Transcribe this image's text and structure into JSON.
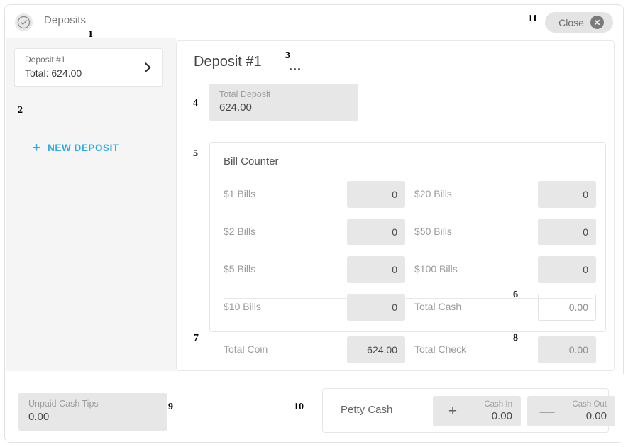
{
  "header": {
    "title": "Deposits",
    "status_icon": "check-circle-icon",
    "close_label": "Close",
    "close_icon": "close-x-icon"
  },
  "sidebar": {
    "deposit_item": {
      "name": "Deposit #1",
      "total": "Total: 624.00",
      "chevron_icon": "chevron-right-icon"
    },
    "new_deposit": {
      "plus": "+",
      "label": "NEW DEPOSIT",
      "color": "#2aabe2"
    }
  },
  "panel": {
    "title": "Deposit #1",
    "overflow_menu_icon": "ellipsis-horizontal-icon",
    "total_deposit": {
      "label": "Total Deposit",
      "value": "624.00"
    },
    "bill_counter": {
      "title": "Bill Counter",
      "rows": [
        {
          "left_label": "$1 Bills",
          "left_value": "0",
          "right_label": "$20 Bills",
          "right_value": "0"
        },
        {
          "left_label": "$2 Bills",
          "left_value": "0",
          "right_label": "$50 Bills",
          "right_value": "0"
        },
        {
          "left_label": "$5 Bills",
          "left_value": "0",
          "right_label": "$100 Bills",
          "right_value": "0"
        },
        {
          "left_label": "$10 Bills",
          "left_value": "0",
          "right_label": "Total Cash",
          "right_value": "0.00"
        }
      ],
      "totals_row": {
        "left_label": "Total Coin",
        "left_value": "624.00",
        "right_label": "Total Check",
        "right_value": "0.00"
      }
    }
  },
  "footer": {
    "unpaid_cash_tips": {
      "label": "Unpaid Cash Tips",
      "value": "0.00"
    },
    "petty_cash": {
      "label": "Petty Cash",
      "cash_in": {
        "sign": "+",
        "caption": "Cash In",
        "value": "0.00"
      },
      "cash_out": {
        "sign": "—",
        "caption": "Cash Out",
        "value": "0.00"
      }
    }
  },
  "markers": {
    "m1": "1",
    "m2": "2",
    "m3": "3",
    "m4": "4",
    "m5": "5",
    "m6": "6",
    "m7": "7",
    "m8": "8",
    "m9": "9",
    "m10": "10",
    "m11": "11"
  }
}
